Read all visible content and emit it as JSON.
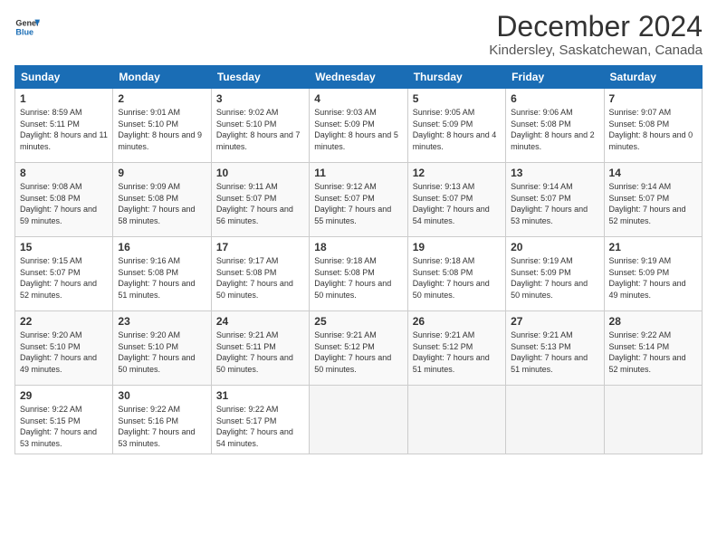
{
  "header": {
    "logo_line1": "General",
    "logo_line2": "Blue",
    "title": "December 2024",
    "subtitle": "Kindersley, Saskatchewan, Canada"
  },
  "days_of_week": [
    "Sunday",
    "Monday",
    "Tuesday",
    "Wednesday",
    "Thursday",
    "Friday",
    "Saturday"
  ],
  "weeks": [
    [
      {
        "day": "1",
        "sunrise": "8:59 AM",
        "sunset": "5:11 PM",
        "daylight": "8 hours and 11 minutes."
      },
      {
        "day": "2",
        "sunrise": "9:01 AM",
        "sunset": "5:10 PM",
        "daylight": "8 hours and 9 minutes."
      },
      {
        "day": "3",
        "sunrise": "9:02 AM",
        "sunset": "5:10 PM",
        "daylight": "8 hours and 7 minutes."
      },
      {
        "day": "4",
        "sunrise": "9:03 AM",
        "sunset": "5:09 PM",
        "daylight": "8 hours and 5 minutes."
      },
      {
        "day": "5",
        "sunrise": "9:05 AM",
        "sunset": "5:09 PM",
        "daylight": "8 hours and 4 minutes."
      },
      {
        "day": "6",
        "sunrise": "9:06 AM",
        "sunset": "5:08 PM",
        "daylight": "8 hours and 2 minutes."
      },
      {
        "day": "7",
        "sunrise": "9:07 AM",
        "sunset": "5:08 PM",
        "daylight": "8 hours and 0 minutes."
      }
    ],
    [
      {
        "day": "8",
        "sunrise": "9:08 AM",
        "sunset": "5:08 PM",
        "daylight": "7 hours and 59 minutes."
      },
      {
        "day": "9",
        "sunrise": "9:09 AM",
        "sunset": "5:08 PM",
        "daylight": "7 hours and 58 minutes."
      },
      {
        "day": "10",
        "sunrise": "9:11 AM",
        "sunset": "5:07 PM",
        "daylight": "7 hours and 56 minutes."
      },
      {
        "day": "11",
        "sunrise": "9:12 AM",
        "sunset": "5:07 PM",
        "daylight": "7 hours and 55 minutes."
      },
      {
        "day": "12",
        "sunrise": "9:13 AM",
        "sunset": "5:07 PM",
        "daylight": "7 hours and 54 minutes."
      },
      {
        "day": "13",
        "sunrise": "9:14 AM",
        "sunset": "5:07 PM",
        "daylight": "7 hours and 53 minutes."
      },
      {
        "day": "14",
        "sunrise": "9:14 AM",
        "sunset": "5:07 PM",
        "daylight": "7 hours and 52 minutes."
      }
    ],
    [
      {
        "day": "15",
        "sunrise": "9:15 AM",
        "sunset": "5:07 PM",
        "daylight": "7 hours and 52 minutes."
      },
      {
        "day": "16",
        "sunrise": "9:16 AM",
        "sunset": "5:08 PM",
        "daylight": "7 hours and 51 minutes."
      },
      {
        "day": "17",
        "sunrise": "9:17 AM",
        "sunset": "5:08 PM",
        "daylight": "7 hours and 50 minutes."
      },
      {
        "day": "18",
        "sunrise": "9:18 AM",
        "sunset": "5:08 PM",
        "daylight": "7 hours and 50 minutes."
      },
      {
        "day": "19",
        "sunrise": "9:18 AM",
        "sunset": "5:08 PM",
        "daylight": "7 hours and 50 minutes."
      },
      {
        "day": "20",
        "sunrise": "9:19 AM",
        "sunset": "5:09 PM",
        "daylight": "7 hours and 50 minutes."
      },
      {
        "day": "21",
        "sunrise": "9:19 AM",
        "sunset": "5:09 PM",
        "daylight": "7 hours and 49 minutes."
      }
    ],
    [
      {
        "day": "22",
        "sunrise": "9:20 AM",
        "sunset": "5:10 PM",
        "daylight": "7 hours and 49 minutes."
      },
      {
        "day": "23",
        "sunrise": "9:20 AM",
        "sunset": "5:10 PM",
        "daylight": "7 hours and 50 minutes."
      },
      {
        "day": "24",
        "sunrise": "9:21 AM",
        "sunset": "5:11 PM",
        "daylight": "7 hours and 50 minutes."
      },
      {
        "day": "25",
        "sunrise": "9:21 AM",
        "sunset": "5:12 PM",
        "daylight": "7 hours and 50 minutes."
      },
      {
        "day": "26",
        "sunrise": "9:21 AM",
        "sunset": "5:12 PM",
        "daylight": "7 hours and 51 minutes."
      },
      {
        "day": "27",
        "sunrise": "9:21 AM",
        "sunset": "5:13 PM",
        "daylight": "7 hours and 51 minutes."
      },
      {
        "day": "28",
        "sunrise": "9:22 AM",
        "sunset": "5:14 PM",
        "daylight": "7 hours and 52 minutes."
      }
    ],
    [
      {
        "day": "29",
        "sunrise": "9:22 AM",
        "sunset": "5:15 PM",
        "daylight": "7 hours and 53 minutes."
      },
      {
        "day": "30",
        "sunrise": "9:22 AM",
        "sunset": "5:16 PM",
        "daylight": "7 hours and 53 minutes."
      },
      {
        "day": "31",
        "sunrise": "9:22 AM",
        "sunset": "5:17 PM",
        "daylight": "7 hours and 54 minutes."
      },
      null,
      null,
      null,
      null
    ]
  ]
}
